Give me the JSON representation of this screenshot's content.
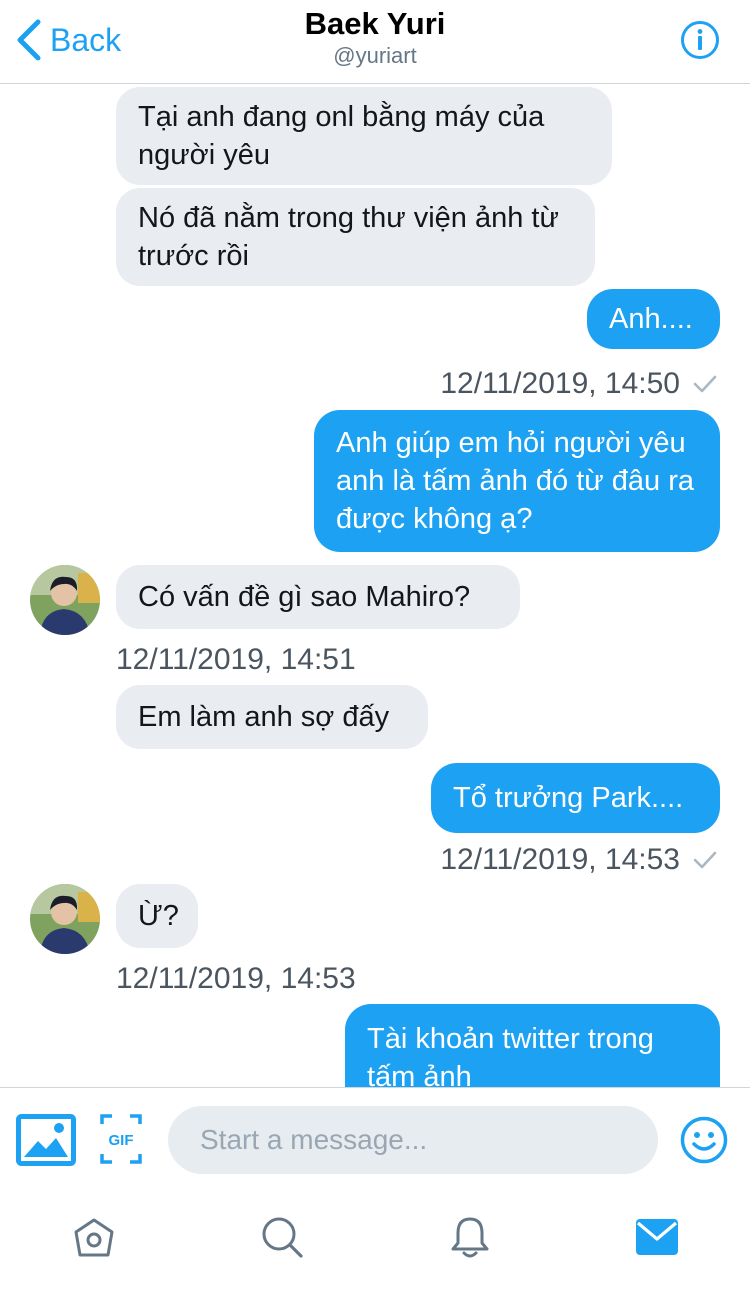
{
  "header": {
    "back_label": "Back",
    "name": "Baek Yuri",
    "handle": "@yuriart"
  },
  "messages": [
    {
      "side": "in",
      "text": "Tại anh đang onl bằng máy của người yêu"
    },
    {
      "side": "in",
      "text": "Nó đã nằm trong thư viện ảnh từ trước rồi"
    },
    {
      "side": "out",
      "text": "Anh...."
    },
    {
      "stamp": "12/11/2019, 14:50",
      "read": true
    },
    {
      "side": "out",
      "text": "Anh giúp em hỏi người yêu anh là tấm ảnh đó từ đâu ra được không ạ?"
    },
    {
      "side": "in",
      "text": "Có vấn đề gì sao Mahiro?"
    },
    {
      "stamp": "12/11/2019, 14:51",
      "read": false
    },
    {
      "side": "in",
      "text": "Em làm anh sợ đấy"
    },
    {
      "side": "out",
      "text": "Tổ trưởng Park...."
    },
    {
      "stamp": "12/11/2019, 14:53",
      "read": true
    },
    {
      "side": "in",
      "text": "Ừ?"
    },
    {
      "stamp": "12/11/2019, 14:53",
      "read": false
    },
    {
      "side": "out",
      "text": "Tài khoản twitter trong tấm ảnh"
    }
  ],
  "composer": {
    "placeholder": "Start a message...",
    "gif_label": "GIF"
  },
  "tabs": [
    "home-icon",
    "search-icon",
    "notifications-icon",
    "messages-icon"
  ],
  "colors": {
    "accent": "#1da1f2",
    "incoming_bubble": "#e9ecf0",
    "outgoing_bubble": "#1da1f2"
  }
}
